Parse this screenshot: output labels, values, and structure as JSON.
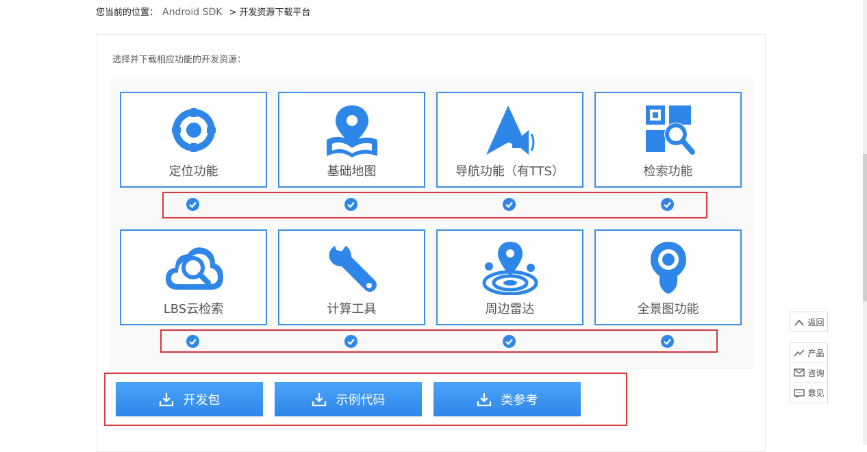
{
  "breadcrumb": {
    "prefix": "您当前的位置：",
    "sdk": "Android SDK",
    "sep": ">",
    "current": "开发资源下载平台"
  },
  "intro": "选择并下载相应功能的开发资源：",
  "features": [
    {
      "label": "定位功能",
      "icon": "location-target-icon"
    },
    {
      "label": "基础地图",
      "icon": "map-pin-icon"
    },
    {
      "label": "导航功能（有TTS）",
      "icon": "navigation-arrow-icon"
    },
    {
      "label": "检索功能",
      "icon": "search-grid-icon"
    },
    {
      "label": "LBS云检索",
      "icon": "cloud-search-icon"
    },
    {
      "label": "计算工具",
      "icon": "wrench-icon"
    },
    {
      "label": "周边雷达",
      "icon": "radar-icon"
    },
    {
      "label": "全景图功能",
      "icon": "panorama-pin-icon"
    }
  ],
  "downloads": {
    "dev_pack": "开发包",
    "sample_code": "示例代码",
    "class_ref": "类参考"
  },
  "side": {
    "back": "返回",
    "product": "产品",
    "consult": "咨询",
    "feedback": "意见"
  },
  "colors": {
    "accent": "#2f86e9",
    "highlight_border": "#d9363e"
  }
}
